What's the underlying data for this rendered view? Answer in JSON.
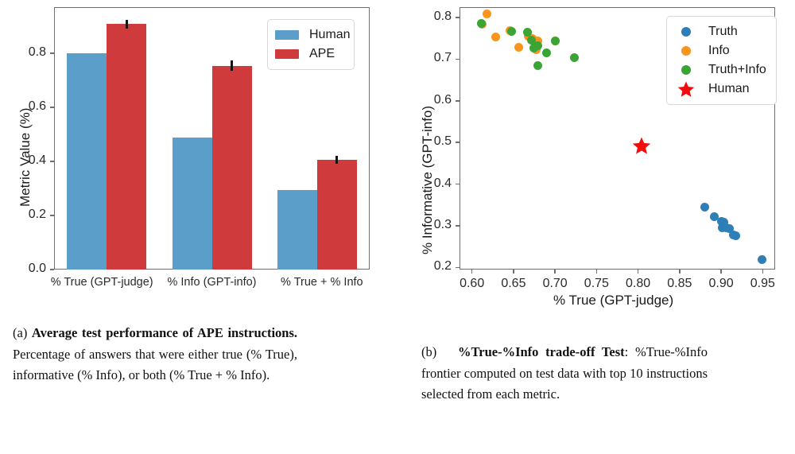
{
  "figure": {
    "panel_a": {
      "caption_tag": "(a)",
      "caption_bold": "Average test performance of APE instructions.",
      "caption_rest": " Percentage of answers that were either true (% True), informative (% Info), or both (% True + % Info)."
    },
    "panel_b": {
      "caption_tag": "(b)",
      "caption_bold": "%True-%Info trade-off Test",
      "caption_rest": ": %True-%Info frontier computed on test data with top 10 instructions selected from each metric."
    }
  },
  "colors": {
    "human_blue": "#5b9ec9",
    "ape_red": "#cf3a3c",
    "truth_blue": "#2e7fb8",
    "info_orange": "#f8951d",
    "truth_info_green": "#3aa435",
    "human_star_red": "#f20d0d",
    "axis_gray": "#6f6f6f"
  },
  "chart_data": [
    {
      "type": "bar",
      "title": "",
      "xlabel": "",
      "ylabel": "Metric Value (%)",
      "categories": [
        "% True (GPT-judge)",
        "% Info (GPT-info)",
        "% True + % Info"
      ],
      "yticks": [
        "0.0",
        "0.2",
        "0.4",
        "0.6",
        "0.8"
      ],
      "ylim": [
        0.0,
        0.97
      ],
      "grid": false,
      "legend_position": "upper right",
      "series": [
        {
          "name": "Human",
          "color": "#5b9ec9",
          "values": [
            0.8,
            0.489,
            0.293
          ],
          "errors": [
            0,
            0,
            0
          ]
        },
        {
          "name": "APE",
          "color": "#cf3a3c",
          "values": [
            0.908,
            0.754,
            0.406
          ],
          "errors": [
            0.016,
            0.018,
            0.014
          ]
        }
      ]
    },
    {
      "type": "scatter",
      "title": "",
      "xlabel": "% True (GPT-judge)",
      "ylabel": "% Informative (GPT-info)",
      "xticks": [
        "0.60",
        "0.65",
        "0.70",
        "0.75",
        "0.80",
        "0.85",
        "0.90",
        "0.95"
      ],
      "yticks": [
        "0.2",
        "0.3",
        "0.4",
        "0.5",
        "0.6",
        "0.7",
        "0.8"
      ],
      "xlim": [
        0.585,
        0.965
      ],
      "ylim": [
        0.195,
        0.825
      ],
      "grid": false,
      "legend_position": "upper right",
      "series": [
        {
          "name": "Truth",
          "color": "#2e7fb8",
          "marker": "circle",
          "points": [
            [
              0.8805,
              0.3445
            ],
            [
              0.892,
              0.3215
            ],
            [
              0.9,
              0.3105
            ],
            [
              0.9035,
              0.309
            ],
            [
              0.901,
              0.296
            ],
            [
              0.906,
              0.2945
            ],
            [
              0.91,
              0.293
            ],
            [
              0.9145,
              0.279
            ],
            [
              0.918,
              0.276
            ],
            [
              0.9495,
              0.2185
            ]
          ]
        },
        {
          "name": "Info",
          "color": "#f8951d",
          "marker": "circle",
          "points": [
            [
              0.6185,
              0.8085
            ],
            [
              0.6125,
              0.7835
            ],
            [
              0.629,
              0.7525
            ],
            [
              0.6455,
              0.769
            ],
            [
              0.656,
              0.729
            ],
            [
              0.668,
              0.756
            ],
            [
              0.6725,
              0.75
            ],
            [
              0.6775,
              0.7235
            ],
            [
              0.679,
              0.7445
            ],
            [
              0.7005,
              0.743
            ]
          ]
        },
        {
          "name": "Truth+Info",
          "color": "#3aa435",
          "marker": "circle",
          "points": [
            [
              0.611,
              0.7865
            ],
            [
              0.6475,
              0.7675
            ],
            [
              0.667,
              0.764
            ],
            [
              0.6715,
              0.746
            ],
            [
              0.679,
              0.6855
            ],
            [
              0.679,
              0.732
            ],
            [
              0.69,
              0.715
            ],
            [
              0.7,
              0.743
            ],
            [
              0.6745,
              0.7275
            ],
            [
              0.723,
              0.703
            ]
          ]
        },
        {
          "name": "Human",
          "color": "#f20d0d",
          "marker": "star",
          "points": [
            [
              0.8045,
              0.4935
            ]
          ]
        }
      ]
    }
  ]
}
